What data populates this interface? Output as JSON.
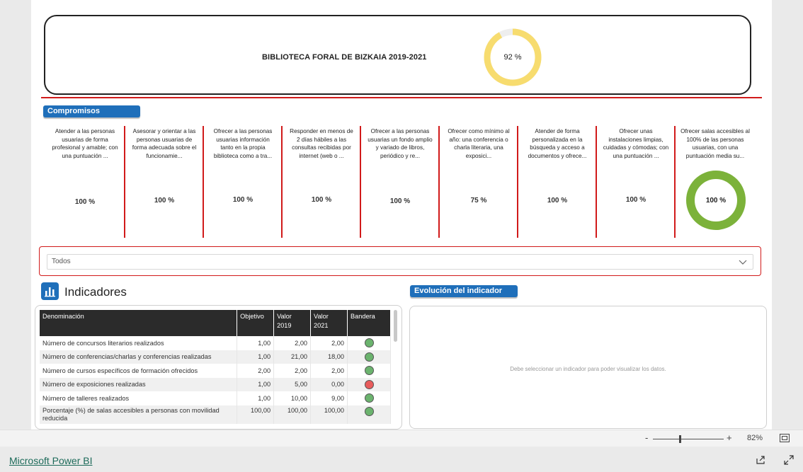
{
  "header": {
    "title": "BIBLIOTECA FORAL DE BIZKAIA 2019-2021",
    "overall_percent": "92 %",
    "overall_value": 0.92,
    "donut_color": "#f7dc6f"
  },
  "commitments_section": {
    "label": "Compromisos",
    "items": [
      {
        "text": "Atender a las personas usuarias de forma profesional y amable; con una puntuación ...",
        "value": "100 %"
      },
      {
        "text": "Asesorar y orientar a las personas usuarias de forma adecuada sobre el funcionamie...",
        "value": "100 %"
      },
      {
        "text": "Ofrecer a las personas usuarias información tanto en la propia biblioteca como a tra...",
        "value": "100 %"
      },
      {
        "text": "Responder en menos de 2 días hábiles a las consultas recibidas por internet (web o ...",
        "value": "100 %"
      },
      {
        "text": "Ofrecer a las personas usuarias un fondo amplio y variado de libros, periódico y re...",
        "value": "100 %"
      },
      {
        "text": "Ofrecer como mínimo al año: una conferencia o charla literaria, una exposici...",
        "value": "75 %"
      },
      {
        "text": "Atender de forma personalizada en la búsqueda y acceso a documentos y ofrece...",
        "value": "100 %"
      },
      {
        "text": "Ofrecer unas instalaciones limpias, cuidadas y cómodas; con una puntuación ...",
        "value": "100 %"
      },
      {
        "text": "Ofrecer salas accesibles al 100% de las personas usuarias, con una puntuación media su...",
        "value": "100 %"
      }
    ],
    "last_donut_value": 1.0,
    "last_donut_color": "#7cb23a"
  },
  "slicer": {
    "selected": "Todos"
  },
  "indicators": {
    "title": "Indicadores",
    "columns": [
      "Denominación",
      "Objetivo",
      "Valor 2019",
      "Valor 2021",
      "Bandera"
    ],
    "rows": [
      {
        "name": "Número de concursos literarios realizados",
        "objetivo": "1,00",
        "v2019": "2,00",
        "v2021": "2,00",
        "flag": "green"
      },
      {
        "name": "Número de conferencias/charlas y conferencias realizadas",
        "objetivo": "1,00",
        "v2019": "21,00",
        "v2021": "18,00",
        "flag": "green"
      },
      {
        "name": "Número de cursos específicos de formación ofrecidos",
        "objetivo": "2,00",
        "v2019": "2,00",
        "v2021": "2,00",
        "flag": "green"
      },
      {
        "name": "Número de exposiciones realizadas",
        "objetivo": "1,00",
        "v2019": "5,00",
        "v2021": "0,00",
        "flag": "red"
      },
      {
        "name": "Número de talleres realizados",
        "objetivo": "1,00",
        "v2019": "10,00",
        "v2021": "9,00",
        "flag": "green"
      },
      {
        "name": "Porcentaje (%) de salas accesibles a personas con movilidad reducida",
        "objetivo": "100,00",
        "v2019": "100,00",
        "v2021": "100,00",
        "flag": "green"
      }
    ],
    "flag_colors": {
      "green": "#6bb36e",
      "red": "#e85c5c"
    }
  },
  "evolution": {
    "label": "Evolución del indicador",
    "empty_message": "Debe seleccionar un indicador para poder visualizar los datos."
  },
  "zoom": {
    "minus": "-",
    "plus": "+",
    "level": "82%"
  },
  "footer": {
    "link": "Microsoft Power BI"
  }
}
